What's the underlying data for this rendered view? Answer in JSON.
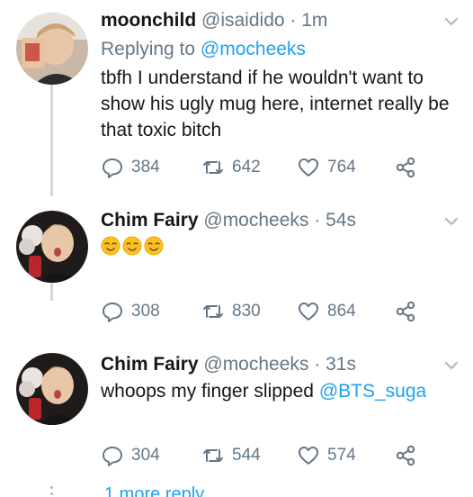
{
  "tweets": [
    {
      "name": "moonchild",
      "handle": "@isaidido",
      "separator": "·",
      "time": "1m",
      "reply_prefix": "Replying to",
      "reply_mention": "@mocheeks",
      "text": "tbfh I understand if he wouldn't want to show his ugly mug here, internet really be that toxic bitch",
      "replies": "384",
      "retweets": "642",
      "likes": "764"
    },
    {
      "name": "Chim Fairy",
      "handle": "@mocheeks",
      "separator": "·",
      "time": "54s",
      "emojis": [
        "smiling-face-emoji",
        "smiling-face-emoji",
        "smiling-face-emoji"
      ],
      "replies": "308",
      "retweets": "830",
      "likes": "864"
    },
    {
      "name": "Chim Fairy",
      "handle": "@mocheeks",
      "separator": "·",
      "time": "31s",
      "text": "whoops my finger slipped",
      "mention": "@BTS_suga",
      "replies": "304",
      "retweets": "544",
      "likes": "574"
    }
  ],
  "more_replies_label": "1 more reply",
  "icons": [
    "reply-icon",
    "retweet-icon",
    "like-icon",
    "share-icon",
    "chevron-down-icon"
  ],
  "colors": {
    "accent": "#1da1f2",
    "muted": "#657786",
    "text": "#14171a",
    "line": "#cfd9de"
  }
}
